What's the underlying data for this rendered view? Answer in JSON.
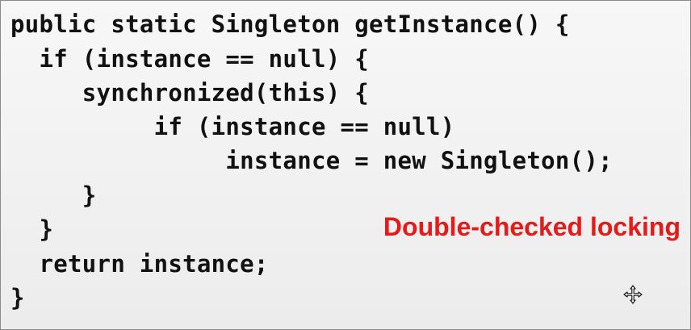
{
  "code": {
    "lines": [
      "public static Singleton getInstance() {",
      "  if (instance == null) {",
      "     synchronized(this) {",
      "          if (instance == null)",
      "               instance = new Singleton();",
      "     }",
      "  }",
      "  return instance;",
      "}"
    ]
  },
  "annotation": {
    "text": "Double-checked locking",
    "color": "#e41b1b"
  },
  "cursor": {
    "icon": "move-cursor-icon"
  }
}
